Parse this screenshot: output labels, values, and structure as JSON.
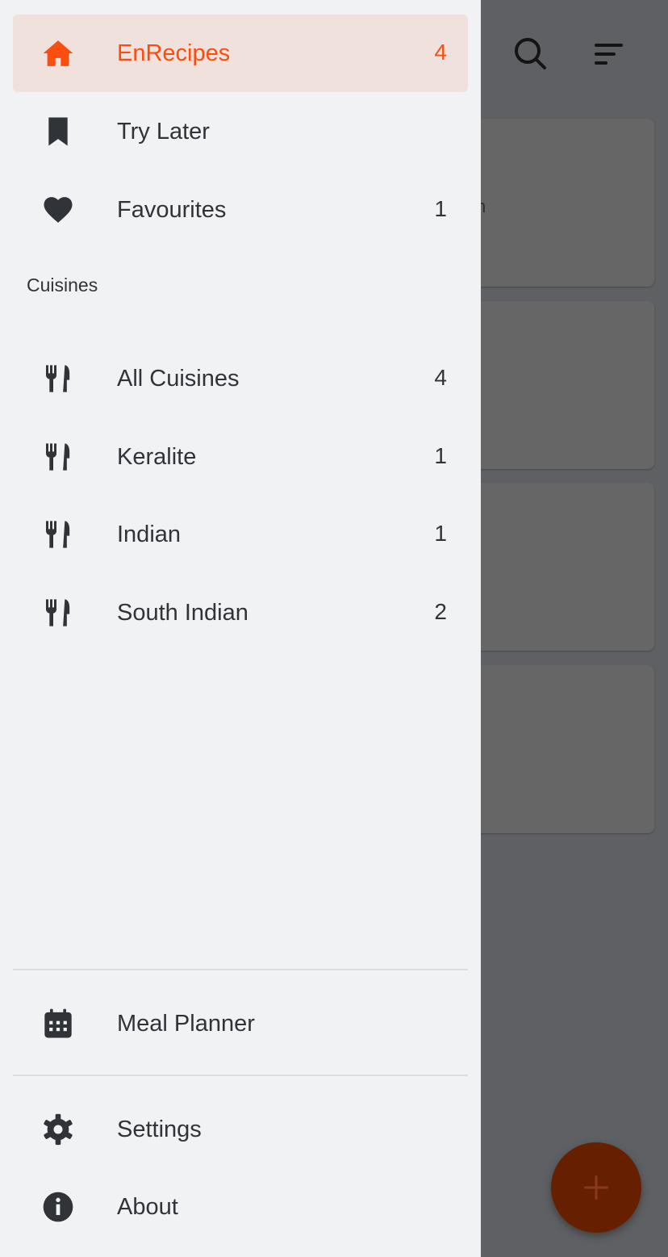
{
  "drawer": {
    "primary_items": [
      {
        "label": "EnRecipes",
        "count": "4",
        "icon": "home-icon",
        "active": true
      },
      {
        "label": "Try Later",
        "count": "",
        "icon": "bookmark-icon",
        "active": false
      },
      {
        "label": "Favourites",
        "count": "1",
        "icon": "heart-icon",
        "active": false
      }
    ],
    "section_title": "Cuisines",
    "cuisines": [
      {
        "label": "All Cuisines",
        "count": "4",
        "icon": "cutlery-icon"
      },
      {
        "label": "Keralite",
        "count": "1",
        "icon": "cutlery-icon"
      },
      {
        "label": "Indian",
        "count": "1",
        "icon": "cutlery-icon"
      },
      {
        "label": "South Indian",
        "count": "2",
        "icon": "cutlery-icon"
      }
    ],
    "meal_planner": {
      "label": "Meal Planner",
      "icon": "calendar-icon"
    },
    "settings": {
      "label": "Settings",
      "icon": "gear-icon"
    },
    "about": {
      "label": "About",
      "icon": "info-icon"
    }
  },
  "background": {
    "toolbar_icons": [
      "search-icon",
      "sort-icon"
    ],
    "card_text_fragment": "n",
    "fab_icon": "plus-icon"
  },
  "colors": {
    "accent": "#fb4d0f",
    "active_bg": "#f1e1dc",
    "drawer_bg": "#f1f2f4",
    "scrim": "#5f6063",
    "fab": "#662000"
  }
}
